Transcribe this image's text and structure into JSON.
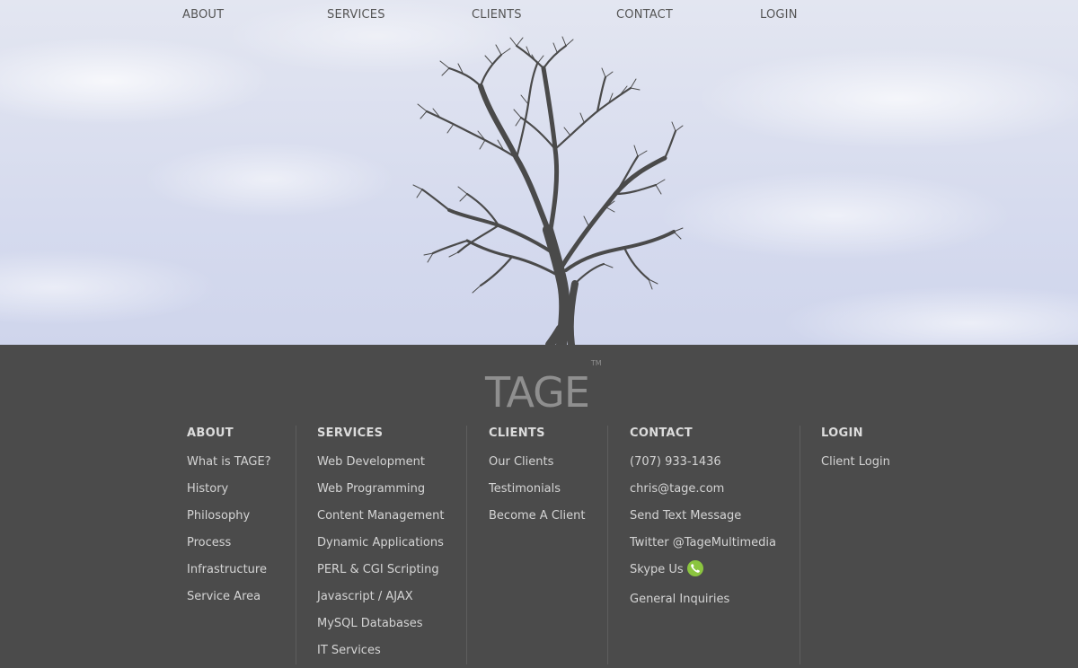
{
  "nav": {
    "items": [
      {
        "label": "ABOUT"
      },
      {
        "label": "SERVICES"
      },
      {
        "label": "CLIENTS"
      },
      {
        "label": "CONTACT"
      },
      {
        "label": "LOGIN"
      }
    ]
  },
  "hero": {
    "image": "bare-tree-icon",
    "sky_color": "#d6dbee",
    "tree_color": "#4a4a4a"
  },
  "footer": {
    "brand": {
      "name": "TAGE",
      "trademark": "TM"
    },
    "background": "#4b4b4b",
    "columns": [
      {
        "heading": "ABOUT",
        "links": [
          "What is TAGE?",
          "History",
          "Philosophy",
          "Process",
          "Infrastructure",
          "Service Area"
        ]
      },
      {
        "heading": "SERVICES",
        "links": [
          "Web Development",
          "Web Programming",
          "Content Management",
          "Dynamic Applications",
          "PERL & CGI Scripting",
          "Javascript / AJAX",
          "MySQL Databases",
          "IT Services"
        ]
      },
      {
        "heading": "CLIENTS",
        "links": [
          "Our Clients",
          "Testimonials",
          "Become A Client"
        ]
      },
      {
        "heading": "CONTACT",
        "links": [
          "(707) 933-1436",
          "chris@tage.com",
          "Send Text Message",
          "Twitter @TageMultimedia",
          "Skype Us",
          "General Inquiries"
        ],
        "icons": {
          "skype": "skype-phone-icon",
          "skype_color": "#8bc53f"
        }
      },
      {
        "heading": "LOGIN",
        "links": [
          "Client Login"
        ]
      }
    ]
  }
}
